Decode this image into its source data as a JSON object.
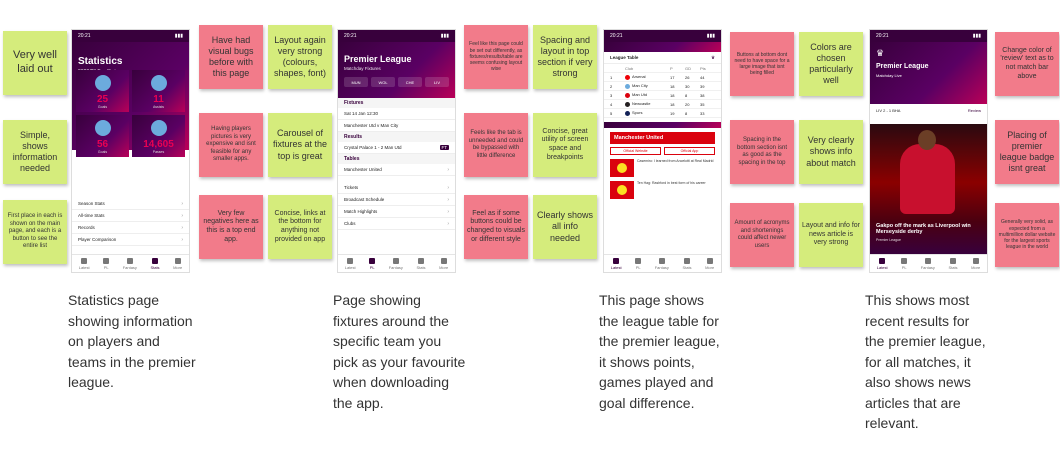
{
  "notes": [
    {
      "text": "Very well laid out",
      "color": "green"
    },
    {
      "text": "Simple, shows information needed",
      "color": "green"
    },
    {
      "text": "First place in each is shown on the main page, and each is a button to see the entire list",
      "color": "green"
    },
    {
      "text": "Have had visual bugs before with this page",
      "color": "pink"
    },
    {
      "text": "Having players pictures is very expensive and isnt feasible for any smaller apps.",
      "color": "pink"
    },
    {
      "text": "Very few negatives here as this is a top end app.",
      "color": "pink"
    },
    {
      "text": "Layout again very strong (colours, shapes, font)",
      "color": "green"
    },
    {
      "text": "Carousel of fixtures at the top is great",
      "color": "green"
    },
    {
      "text": "Concise, links at the bottom for anything not provided on app",
      "color": "green"
    },
    {
      "text": "Feel like this page could be set out differently, as fixtures/results/table are seems confusing layout wise",
      "color": "pink"
    },
    {
      "text": "Feels like the tab is unneeded and could be bypassed with little difference",
      "color": "pink"
    },
    {
      "text": "Feel as if some buttons could be changed to visuals or different style",
      "color": "pink"
    },
    {
      "text": "Spacing and layout in top section if very strong",
      "color": "green"
    },
    {
      "text": "Concise, great utility of screen space and breakpoints",
      "color": "green"
    },
    {
      "text": "Clearly shows all info needed",
      "color": "green"
    },
    {
      "text": "Buttons at bottom dont need to have space for a large image that isnt being filled",
      "color": "pink"
    },
    {
      "text": "Spacing in the bottom section isnt as good as the spacing in the top",
      "color": "pink"
    },
    {
      "text": "Amount of acronyms and shortenings could affect newer users",
      "color": "pink"
    },
    {
      "text": "Colors are chosen particularly well",
      "color": "green"
    },
    {
      "text": "Very clearly shows info about match",
      "color": "green"
    },
    {
      "text": "Layout and info for news article is very strong",
      "color": "green"
    },
    {
      "text": "Change color of 'review' text as to not match bar above",
      "color": "pink"
    },
    {
      "text": "Placing of premier league badge isnt great",
      "color": "pink"
    },
    {
      "text": "Generally very solid, as expected from a multimillion dollar website for the largest sports league in the world",
      "color": "pink"
    }
  ],
  "captions": [
    "Statistics page showing information on players and teams in the premier league.",
    "Page showing fixtures around the specific team you pick as your favourite when downloading the app.",
    "This page shows the league table for the premier league, it shows points, games played and goal difference.",
    "This shows most recent results for the premier league, for all matches, it also shows news articles that are relevant."
  ],
  "phones": {
    "time": "20:21",
    "nav": [
      "Latest",
      "PL",
      "Fantasy",
      "Stats",
      "More"
    ],
    "stats": {
      "title": "Statistics",
      "subtitle": "2022/23 Top Stats",
      "cells": [
        {
          "value": "25",
          "label": "Goals"
        },
        {
          "value": "11",
          "label": "Assists"
        },
        {
          "value": "56",
          "label": "Goals"
        },
        {
          "value": "14,605",
          "label": "Passes"
        }
      ],
      "rows": [
        "Season Stats",
        "All-time Stats",
        "Records",
        "Player Comparison"
      ]
    },
    "fixtures": {
      "title": "Premier League",
      "subtitle": "Matchday Fixtures",
      "chips": [
        "MUN",
        "WOL",
        "CHE",
        "LIV"
      ],
      "sections": [
        {
          "header": "Fixtures",
          "rows": [
            "Sat 14 Jan 12:30",
            "Manchester Utd v Man City"
          ]
        },
        {
          "header": "Results",
          "rows": [
            "Crystal Palace 1 - 2 Man Utd"
          ]
        },
        {
          "header": "Tables",
          "rows": [
            "Manchester United"
          ]
        }
      ],
      "links": [
        "Tickets",
        "Broadcast Schedule",
        "Match Highlights",
        "Clubs"
      ]
    },
    "table": {
      "title": "League Table",
      "headers": [
        "Club",
        "P",
        "GD",
        "Pts"
      ],
      "rows": [
        {
          "pos": "1",
          "team": "Arsenal",
          "p": "17",
          "gd": "26",
          "pts": "44",
          "color": "#ef0107"
        },
        {
          "pos": "2",
          "team": "Man City",
          "p": "18",
          "gd": "30",
          "pts": "39",
          "color": "#6cabdd"
        },
        {
          "pos": "3",
          "team": "Man Utd",
          "p": "18",
          "gd": "8",
          "pts": "38",
          "color": "#da020e"
        },
        {
          "pos": "4",
          "team": "Newcastle",
          "p": "18",
          "gd": "20",
          "pts": "35",
          "color": "#241f20"
        },
        {
          "pos": "5",
          "team": "Spurs",
          "p": "19",
          "gd": "8",
          "pts": "33",
          "color": "#132257"
        }
      ],
      "club": "Manchester United",
      "club_buttons": [
        "Official Website",
        "Official App"
      ],
      "news": [
        "Casemiro: I learned from Ancelotti at Real Madrid",
        "Ten Hag: Rashford in best form of his career"
      ]
    },
    "results": {
      "title": "Premier League",
      "subtitle": "Matchday Live",
      "score": "LIV 2 - 1 BHA",
      "review": "Review",
      "headline": "Gakpo off the mark as Liverpool win Merseyside derby",
      "headline_sub": "Premier League"
    }
  }
}
